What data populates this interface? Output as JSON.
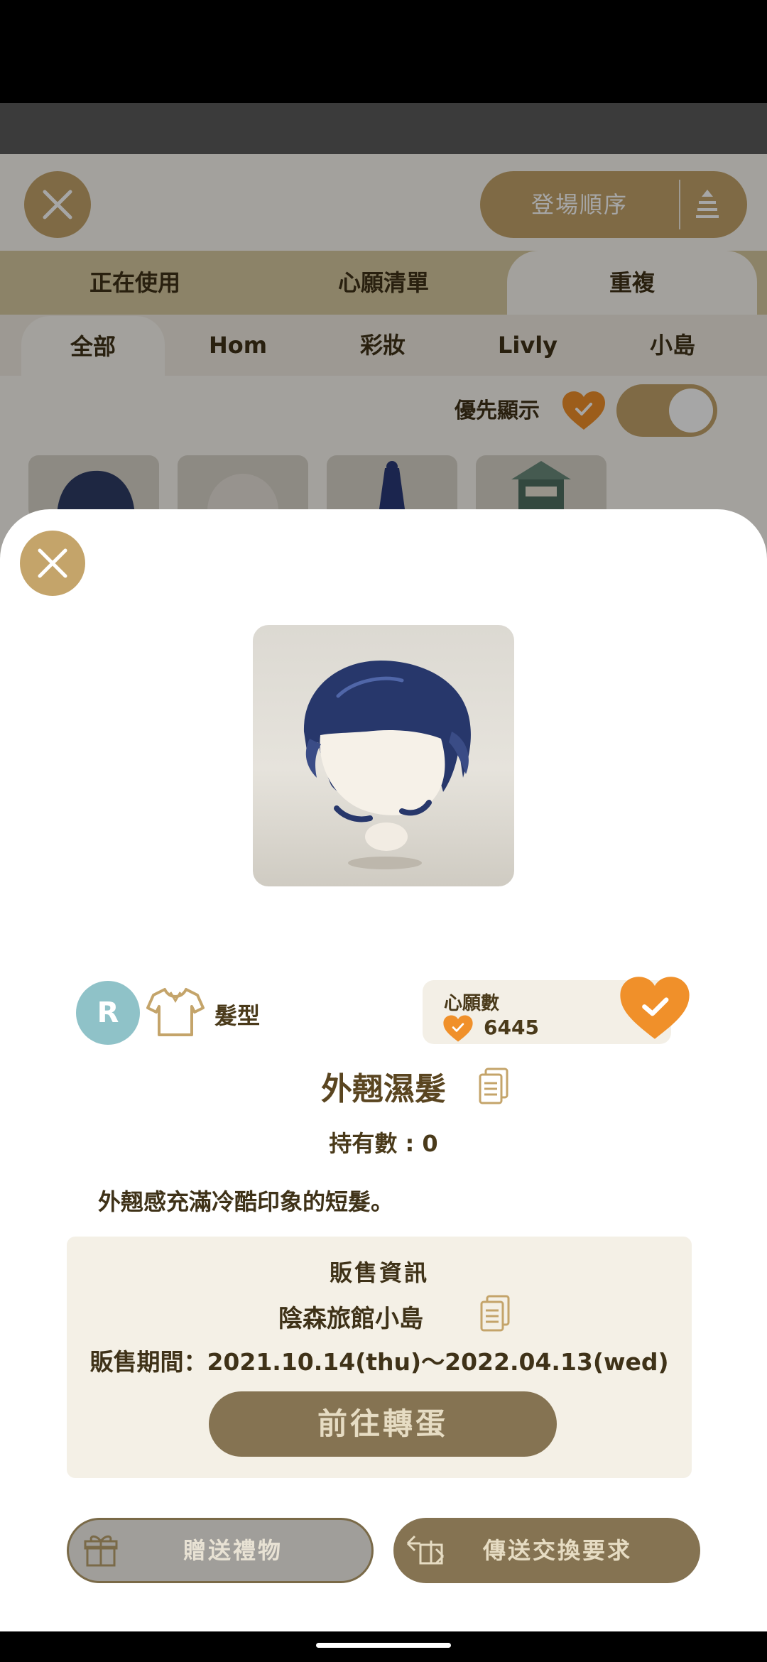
{
  "background": {
    "sort_label": "登場順序",
    "tabs": [
      {
        "label": "正在使用",
        "active": false
      },
      {
        "label": "心願清單",
        "active": false
      },
      {
        "label": "重複",
        "active": true
      }
    ],
    "subtabs": [
      {
        "label": "全部",
        "active": true
      },
      {
        "label": "Hom",
        "active": false
      },
      {
        "label": "彩妝",
        "active": false
      },
      {
        "label": "Livly",
        "active": false
      },
      {
        "label": "小島",
        "active": false
      }
    ],
    "priority_label": "優先顯示",
    "priority_toggle_on": true
  },
  "item": {
    "rarity": "R",
    "category": "髮型",
    "wish_label": "心願數",
    "wish_count": "6445",
    "name": "外翹濕髮",
    "owned": "持有數 : 0",
    "description": "外翹感充滿冷酷印象的短髮。"
  },
  "sale": {
    "title": "販售資訊",
    "location": "陰森旅館小島",
    "period": "販售期間：2021.10.14(thu)〜2022.04.13(wed)",
    "gacha_button": "前往轉蛋"
  },
  "actions": {
    "gift": "贈送禮物",
    "trade": "傳送交換要求"
  },
  "colors": {
    "accent_gold": "#c4a46a",
    "button_brown": "#857352",
    "heart_orange": "#f0902a",
    "rarity_teal": "#8fc2c8"
  }
}
